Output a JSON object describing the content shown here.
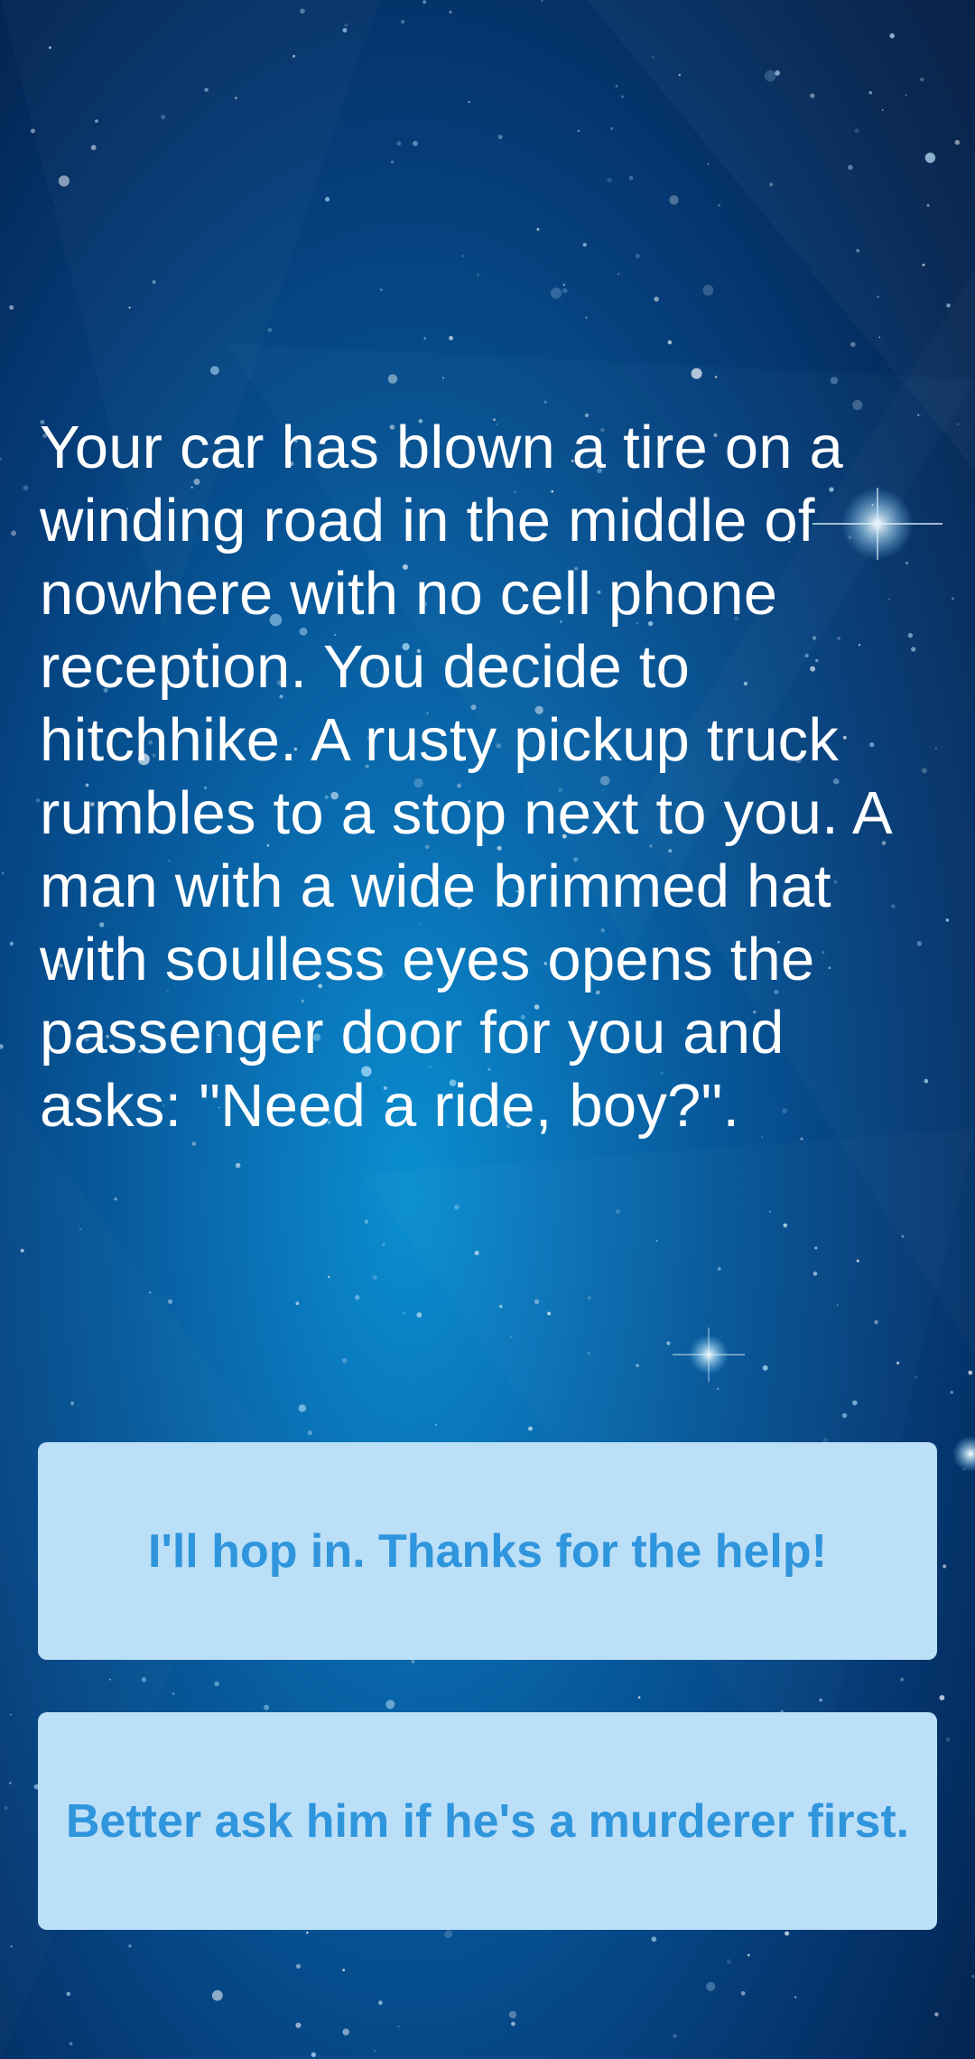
{
  "story": {
    "text": "Your car has blown a tire on a winding road in the middle of nowhere with no cell phone reception. You decide to hitchhike. A rusty pickup truck rumbles to a stop next to you. A man with a wide brimmed hat with soulless eyes opens the passenger door for you and asks: \"Need a ride, boy?\"."
  },
  "choices": [
    {
      "label": "I'll hop in. Thanks for the help!"
    },
    {
      "label": "Better ask him if he's a murderer first."
    }
  ],
  "colors": {
    "button_background": "#bcdff8",
    "button_text": "#2f95dc",
    "story_text": "#ffffff",
    "background_dark": "#031b42",
    "background_glow": "#0a8fd0"
  }
}
